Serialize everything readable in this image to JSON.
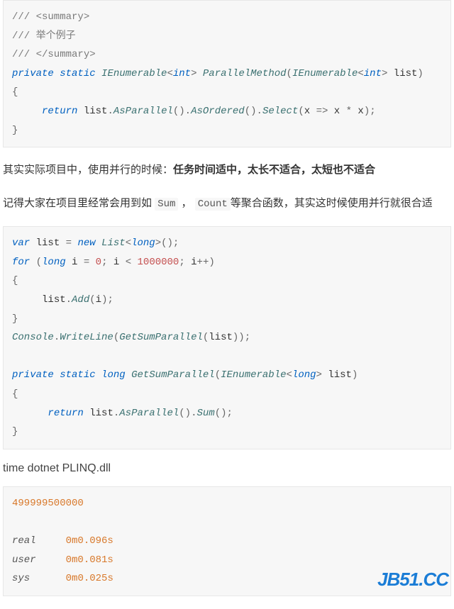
{
  "code1": {
    "l1": "/// <summary>",
    "l2": "/// 举个例子",
    "l3": "/// </summary>",
    "l4a": "private",
    "l4b": "static",
    "l4c": "IEnumerable",
    "l4d": "int",
    "l4e": "ParallelMethod",
    "l4f": "IEnumerable",
    "l4g": "int",
    "l4h": "list",
    "l5": "{",
    "l6a": "return",
    "l6b": "list",
    "l6c": "AsParallel",
    "l6d": "AsOrdered",
    "l6e": "Select",
    "l6f": "x",
    "l6g": "x",
    "l6h": "x",
    "l7": "}"
  },
  "para1": {
    "t1": "其实实际项目中，使用并行的时候：",
    "t2": "任务时间适中，太长不适合，太短也不适合"
  },
  "para2": {
    "t1": "记得大家在项目里经常会用到如 ",
    "c1": "Sum",
    "t2": " ， ",
    "c2": "Count",
    "t3": "等聚合函数，其实这时候使用并行就很合适"
  },
  "code2": {
    "l1a": "var",
    "l1b": "list",
    "l1c": "new",
    "l1d": "List",
    "l1e": "long",
    "l2a": "for",
    "l2b": "long",
    "l2c": "i",
    "l2d": "0",
    "l2e": "i",
    "l2f": "1000000",
    "l2g": "i",
    "l3": "{",
    "l4a": "list",
    "l4b": "Add",
    "l4c": "i",
    "l5": "}",
    "l6a": "Console",
    "l6b": "WriteLine",
    "l6c": "GetSumParallel",
    "l6d": "list",
    "l8a": "private",
    "l8b": "static",
    "l8c": "long",
    "l8d": "GetSumParallel",
    "l8e": "IEnumerable",
    "l8f": "long",
    "l8g": "list",
    "l9": "{",
    "l10a": "return",
    "l10b": "list",
    "l10c": "AsParallel",
    "l10d": "Sum",
    "l11": "}"
  },
  "cmd": "time dotnet PLINQ.dll",
  "result": {
    "sum": "499999500000",
    "real_lbl": "real",
    "real_val": "0m0.096s",
    "user_lbl": "user",
    "user_val": "0m0.081s",
    "sys_lbl": "sys",
    "sys_val": "0m0.025s"
  },
  "watermark": "JB51.CC"
}
